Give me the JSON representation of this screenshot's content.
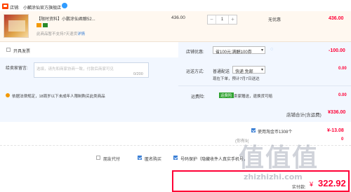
{
  "shop": {
    "label": "店铺:",
    "name": "小麟涂仙官方旗舰店"
  },
  "product": {
    "title": "【限时资料】小鹏涂仙君酿52...",
    "return_note": "此商品暂不支持7天退货",
    "details_link": "详情",
    "unit_price": "436.00",
    "quantity": "1",
    "discount": "无优惠",
    "subtotal": "436.00"
  },
  "invoice": {
    "label": "开具发票"
  },
  "message": {
    "label": "给卖家留言:",
    "placeholder": "选填，请先和商家协商一致，付款后商家可见",
    "count": "0/200"
  },
  "legal": {
    "text": "依据法律规定，18周岁以下未成年人限制购买此类商品"
  },
  "coupon": {
    "label": "店铺优惠:",
    "selected": "省100元:满酬100券",
    "amount": "-100.00"
  },
  "shipping": {
    "label": "运送方式:",
    "type": "普通配送",
    "option": "快递 免邮",
    "eta": "现在下单，预计7月7日送达",
    "amount": "0.00"
  },
  "insurance": {
    "label": "运费险:",
    "tag": "运费险",
    "text": "卖家赠送，退换货可赔",
    "amount": "0.00"
  },
  "store_total": {
    "label": "店铺合计(含运费)",
    "amount": "¥336.00"
  },
  "taobao_coin": {
    "label": "使用淘金币1308个",
    "amount": "¥-13.08",
    "available_label": "(你有9(",
    "extra_amount": "0"
  },
  "options": {
    "friend_pay": "朋友代付",
    "anonymous": "匿名购买",
    "privacy": "号码保护（隐藏收件人真实手机号，"
  },
  "payment": {
    "label": "实付款:",
    "currency": "¥",
    "amount": "322.92"
  },
  "watermark": {
    "glyphs": "值值值",
    "url": "zhizhizhi.com"
  },
  "colors": {
    "accent": "#ff0036",
    "panel_bg": "#f2f7ff",
    "link": "#3a7fd5"
  }
}
